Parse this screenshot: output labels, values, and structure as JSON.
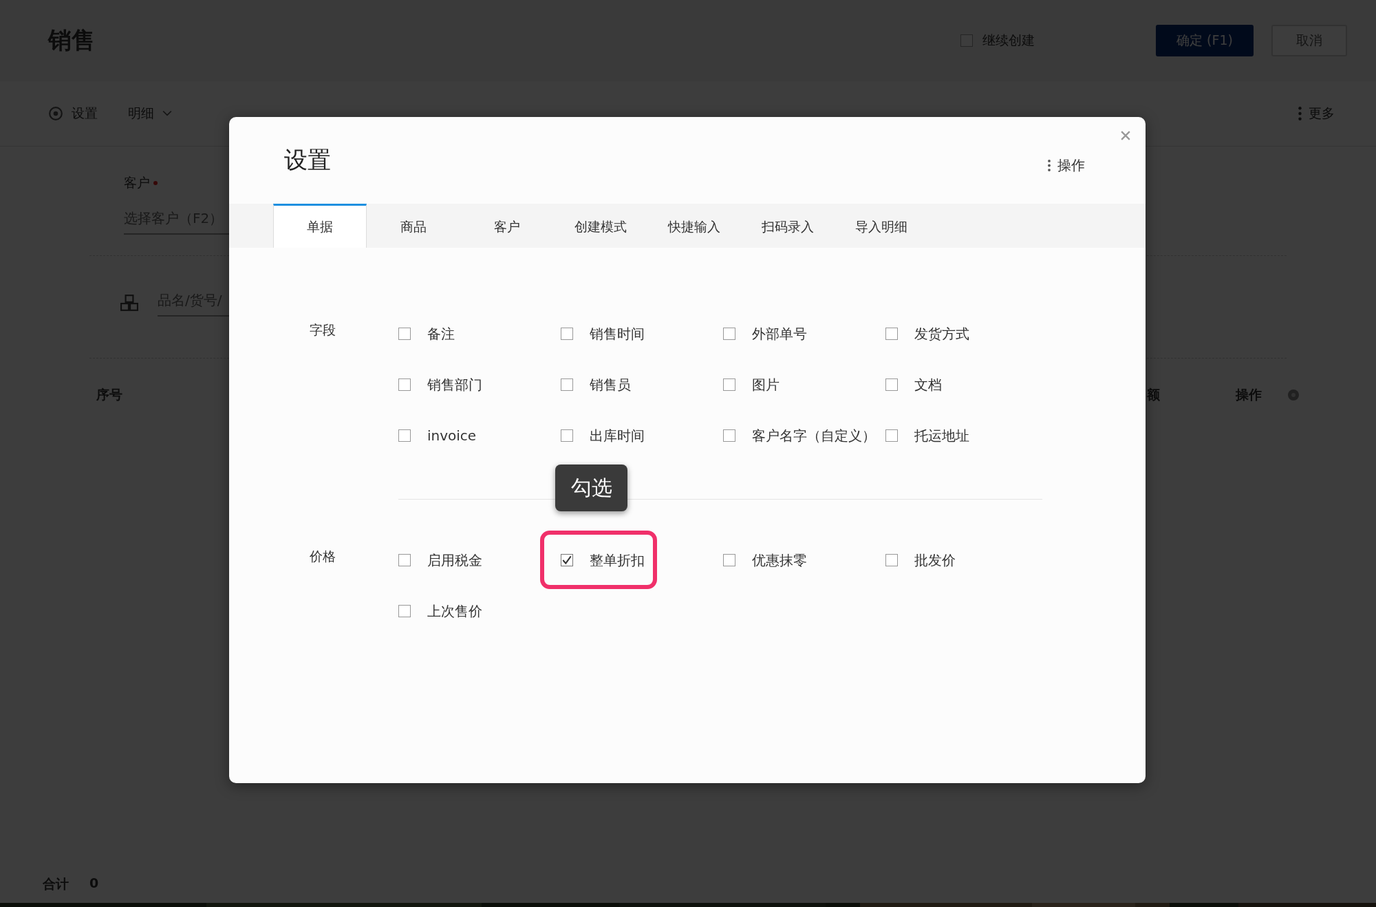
{
  "background_page": {
    "title": "销售",
    "continue_create": {
      "label": "继续创建",
      "checked": false
    },
    "buttons": [
      {
        "label": "确定 (F1)",
        "kind": "primary"
      },
      {
        "label": "取消",
        "kind": "default"
      }
    ],
    "toolbar": [
      {
        "label": "设置",
        "kind": "settings"
      },
      {
        "label": "明细",
        "kind": "dropdown"
      }
    ],
    "more": "更多",
    "customer": {
      "label": "客户",
      "required": true,
      "placeholder": "选择客户（F2）"
    },
    "product_search": {
      "placeholder": "品名/货号/"
    },
    "table": {
      "columns": [
        "序号",
        "额",
        "操作"
      ]
    },
    "footer": {
      "label": "合计",
      "value": "0"
    }
  },
  "dialog": {
    "title": "设置",
    "action": "操作",
    "tabs": [
      {
        "label": "单据",
        "selected": true
      },
      {
        "label": "商品",
        "selected": false
      },
      {
        "label": "客户",
        "selected": false
      },
      {
        "label": "创建模式",
        "selected": false
      },
      {
        "label": "快捷输入",
        "selected": false
      },
      {
        "label": "扫码录入",
        "selected": false
      },
      {
        "label": "导入明细",
        "selected": false
      }
    ],
    "sections": [
      {
        "label": "字段",
        "options": [
          {
            "label": "备注",
            "checked": false,
            "highlighted": false
          },
          {
            "label": "销售时间",
            "checked": false,
            "highlighted": false
          },
          {
            "label": "外部单号",
            "checked": false,
            "highlighted": false
          },
          {
            "label": "发货方式",
            "checked": false,
            "highlighted": false
          },
          {
            "label": "销售部门",
            "checked": false,
            "highlighted": false
          },
          {
            "label": "销售员",
            "checked": false,
            "highlighted": false
          },
          {
            "label": "图片",
            "checked": false,
            "highlighted": false
          },
          {
            "label": "文档",
            "checked": false,
            "highlighted": false
          },
          {
            "label": "invoice",
            "checked": false,
            "highlighted": false
          },
          {
            "label": "出库时间",
            "checked": false,
            "highlighted": false
          },
          {
            "label": "客户名字（自定义）",
            "checked": false,
            "highlighted": false
          },
          {
            "label": "托运地址",
            "checked": false,
            "highlighted": false
          }
        ]
      },
      {
        "label": "价格",
        "options": [
          {
            "label": "启用税金",
            "checked": false,
            "highlighted": false
          },
          {
            "label": "整单折扣",
            "checked": true,
            "highlighted": true
          },
          {
            "label": "优惠抹零",
            "checked": false,
            "highlighted": false
          },
          {
            "label": "批发价",
            "checked": false,
            "highlighted": false
          },
          {
            "label": "上次售价",
            "checked": false,
            "highlighted": false
          }
        ]
      }
    ],
    "tooltip": "勾选"
  }
}
